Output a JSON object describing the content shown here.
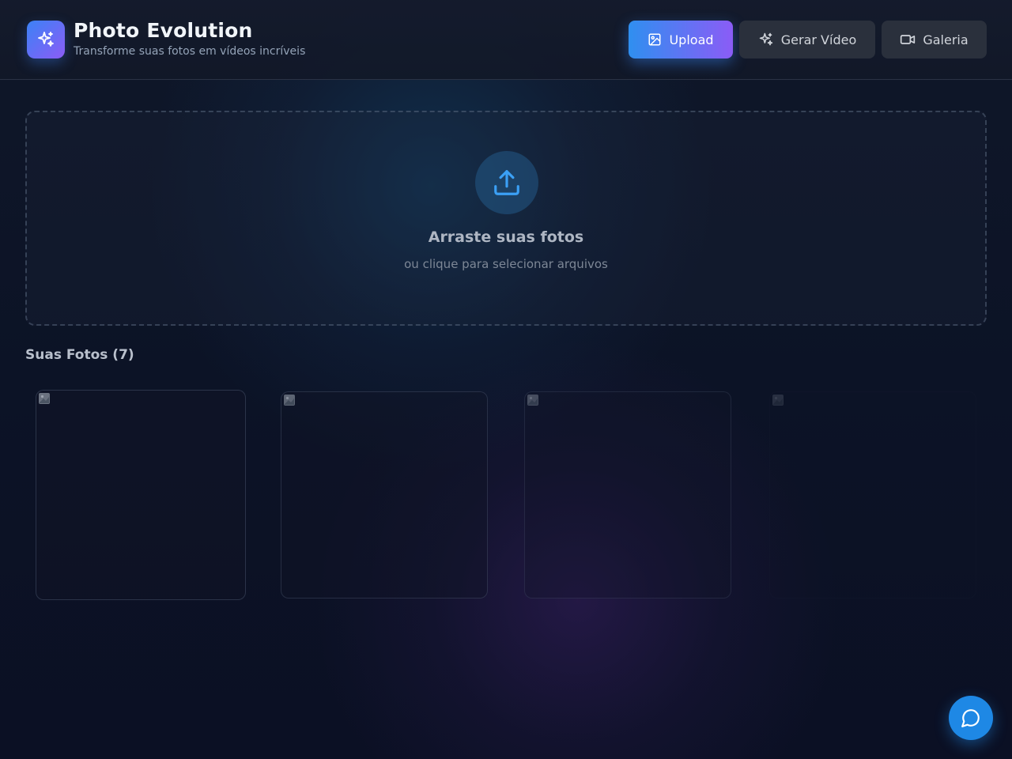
{
  "header": {
    "title": "Photo Evolution",
    "subtitle": "Transforme suas fotos em vídeos incríveis",
    "logo_icon": "sparkles-icon"
  },
  "nav": {
    "upload_label": "Upload",
    "video_label": "Gerar Vídeo",
    "gallery_label": "Galeria",
    "active": "upload"
  },
  "dropzone": {
    "title": "Arraste suas fotos",
    "subtitle": "ou clique para selecionar arquivos",
    "icon": "upload-icon"
  },
  "photos": {
    "section_label": "Suas Fotos (7)",
    "visible_cards": 4
  },
  "chat": {
    "icon": "chat-bubble-icon"
  },
  "colors": {
    "accent_start": "#2f8ff0",
    "accent_end": "#8b5cf6",
    "chat_button": "#1e88e5"
  }
}
